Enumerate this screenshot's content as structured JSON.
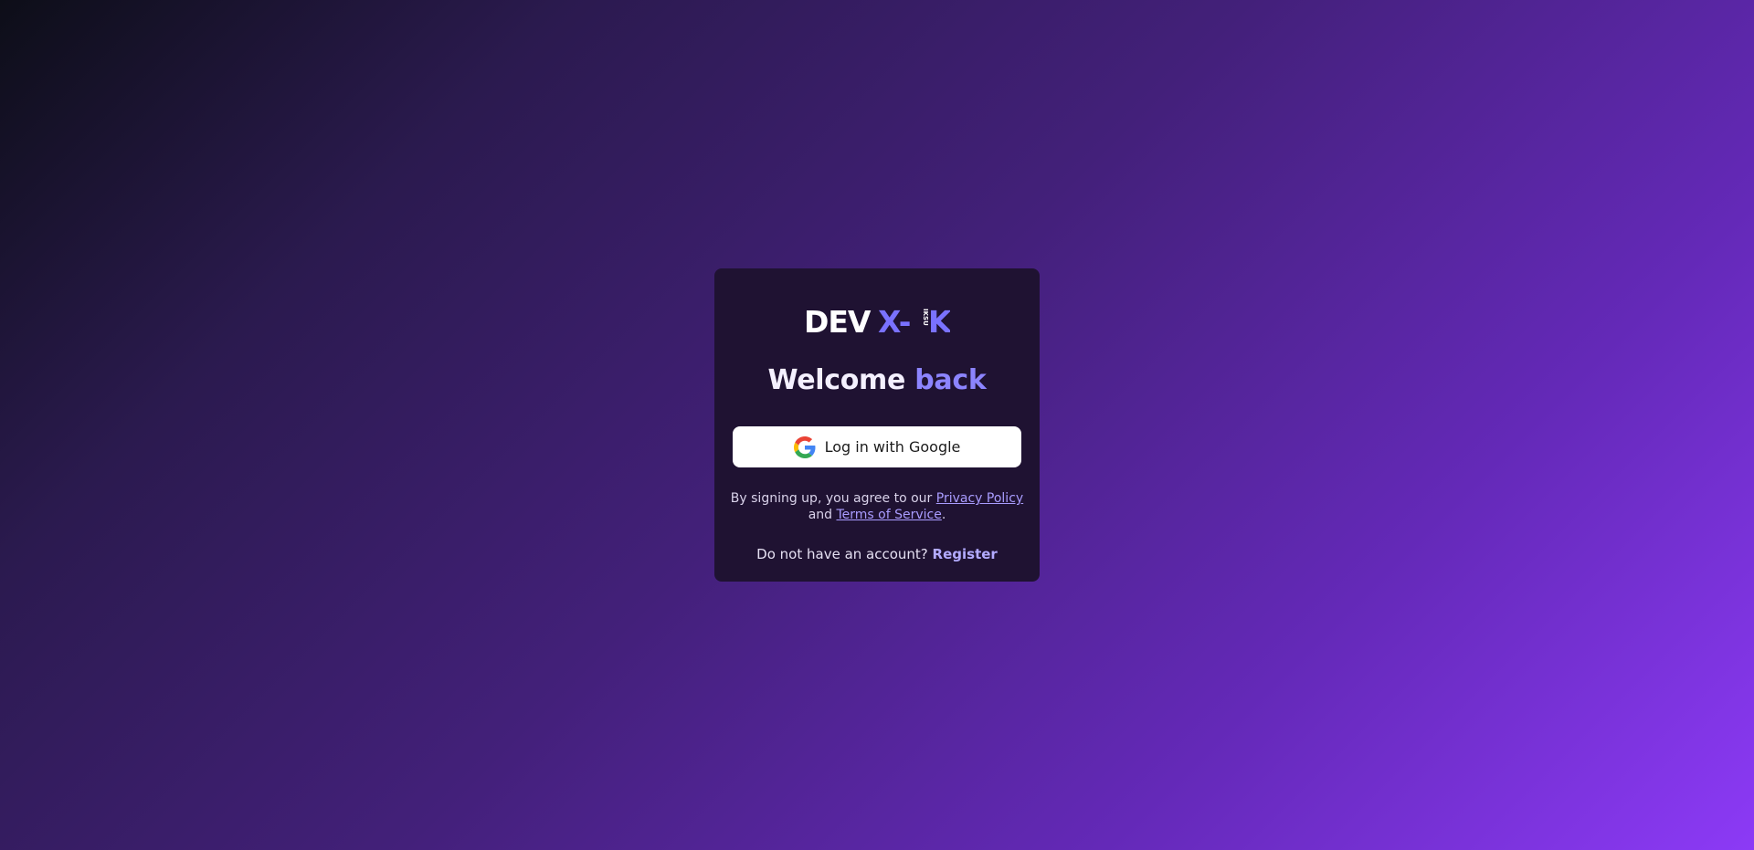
{
  "brand": {
    "logo_text_main": "DEV",
    "logo_text_x": "X-",
    "logo_text_k": "K",
    "logo_vertical": "IKSU"
  },
  "heading": {
    "welcome": "Welcome",
    "accent": "back"
  },
  "google_button": {
    "label": "Log in with Google",
    "icon": "google-g-icon"
  },
  "legal": {
    "prefix": "By signing up, you agree to our",
    "privacy_link": "Privacy Policy",
    "and": "and",
    "terms_link": "Terms of Service",
    "suffix": "."
  },
  "register": {
    "prompt": "Do not have an account?",
    "link": "Register"
  },
  "colors": {
    "accent": "#8c84ff",
    "card_bg": "#1f1232",
    "link": "#a99cff"
  }
}
